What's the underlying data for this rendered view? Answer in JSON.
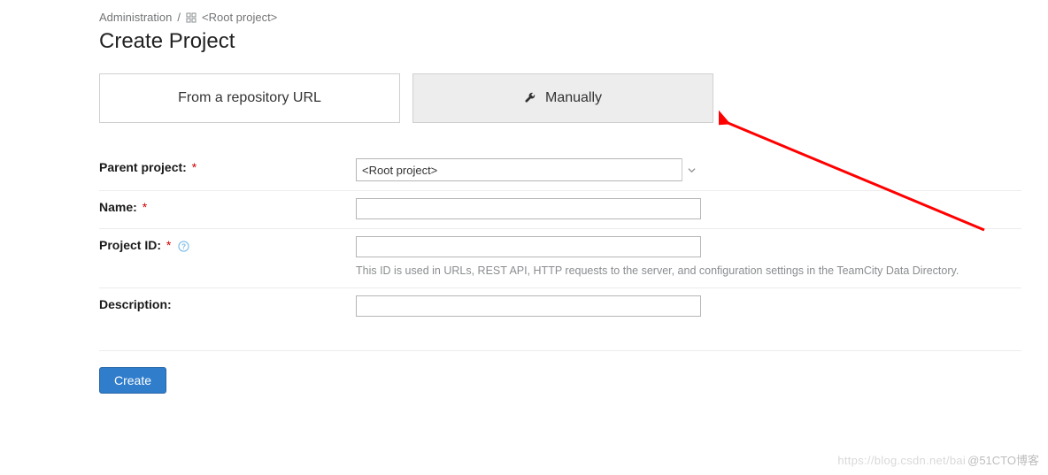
{
  "breadcrumb": {
    "admin": "Administration",
    "separator": "/",
    "root": "<Root project>"
  },
  "page_title": "Create Project",
  "tabs": {
    "repo": "From a repository URL",
    "manual": "Manually"
  },
  "form": {
    "parent": {
      "label": "Parent project:",
      "required": "*",
      "value": "<Root project>"
    },
    "name": {
      "label": "Name:",
      "required": "*",
      "value": ""
    },
    "project_id": {
      "label": "Project ID:",
      "required": "*",
      "value": "",
      "help": "This ID is used in URLs, REST API, HTTP requests to the server, and configuration settings in the TeamCity Data Directory."
    },
    "description": {
      "label": "Description:",
      "value": ""
    }
  },
  "actions": {
    "create": "Create"
  },
  "watermark": {
    "part1": "https://blog.csdn.net/bai",
    "part2": "@51CTO博客"
  }
}
